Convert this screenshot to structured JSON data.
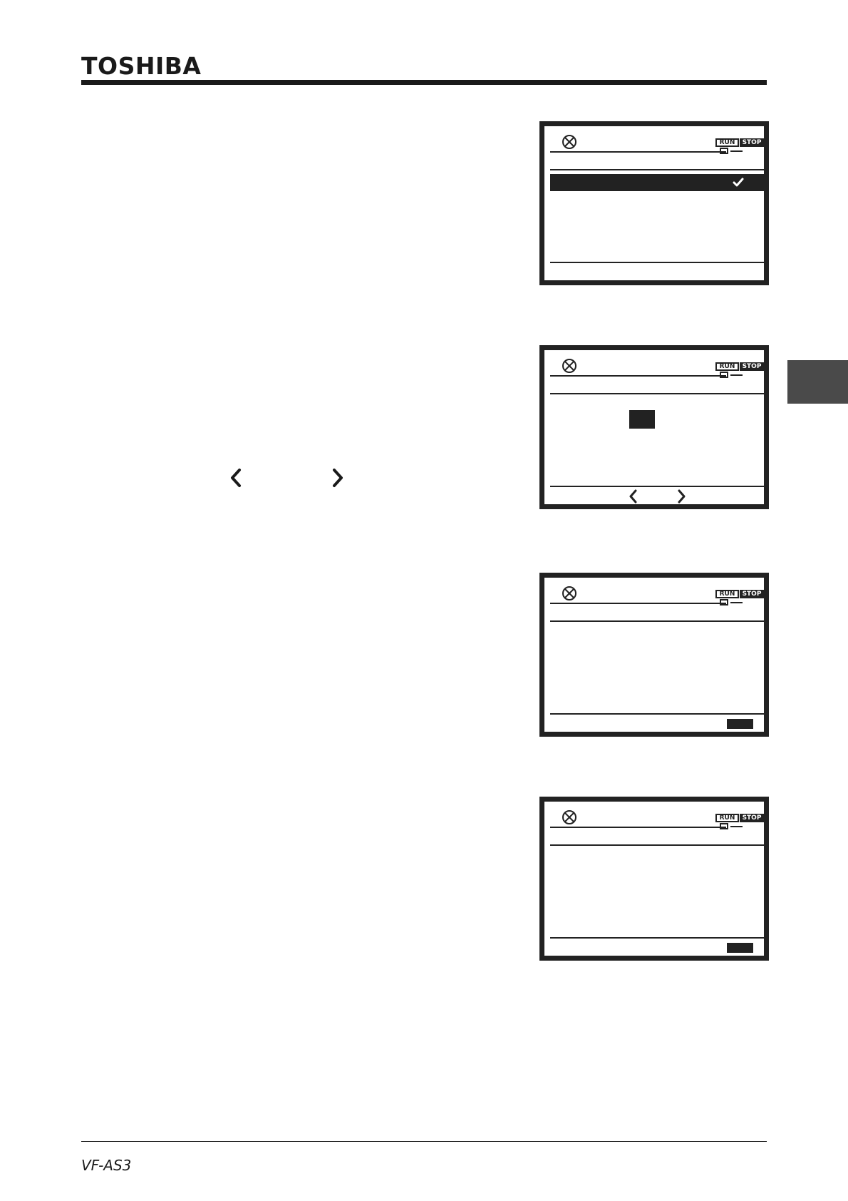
{
  "header": {
    "brand": "TOSHIBA"
  },
  "instruction_arrows": [
    {
      "icon": "chevron-left-icon"
    },
    {
      "icon": "chevron-right-icon"
    }
  ],
  "screens": [
    {
      "status": {
        "run_label": "RUN",
        "stop_label": "STOP"
      },
      "selected_row": {
        "icon": "check-icon"
      }
    },
    {
      "status": {
        "run_label": "RUN",
        "stop_label": "STOP"
      },
      "footer_keys": [
        "chevron-left-icon",
        "chevron-right-icon"
      ]
    },
    {
      "status": {
        "run_label": "RUN",
        "stop_label": "STOP"
      },
      "footer_keys": [
        "function-key"
      ]
    },
    {
      "status": {
        "run_label": "RUN",
        "stop_label": "STOP"
      },
      "footer_keys": [
        "function-key"
      ]
    }
  ],
  "footer": {
    "model": "VF-AS3"
  },
  "colors": {
    "ink": "#1a1a1a",
    "tab_marker": "#4a4a4a"
  }
}
